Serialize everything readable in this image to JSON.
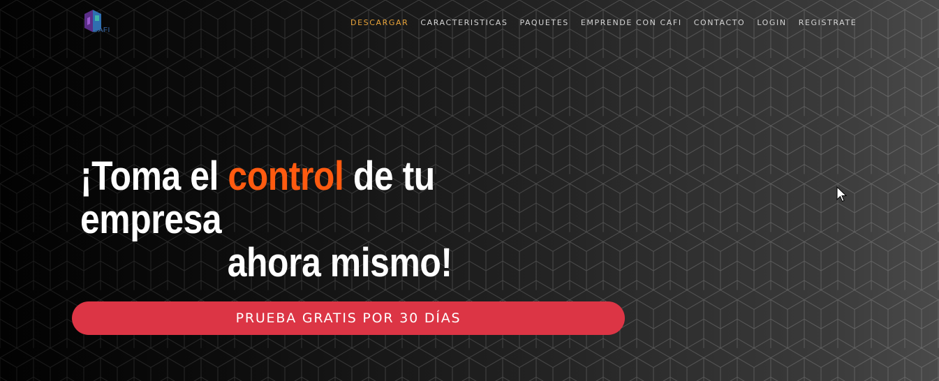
{
  "logo": {
    "text": "CAFI"
  },
  "nav": {
    "items": [
      {
        "label": "DESCARGAR",
        "active": true
      },
      {
        "label": "CARACTERISTICAS"
      },
      {
        "label": "PAQUETES"
      },
      {
        "label": "EMPRENDE CON CAFI"
      },
      {
        "label": "CONTACTO"
      },
      {
        "label": "LOGIN"
      },
      {
        "label": "REGISTRATE"
      }
    ]
  },
  "hero": {
    "headline_prefix": "¡Toma el ",
    "headline_accent": "control",
    "headline_suffix": " de tu empresa",
    "headline_line2": "ahora mismo!",
    "cta_label": "PRUEBA GRATIS POR 30 DÍAS"
  },
  "colors": {
    "nav_active": "#e9a43a",
    "accent": "#ff5a10",
    "cta_background": "#dc3545",
    "background_dark": "#050505",
    "background_light": "#4a4a4a"
  },
  "icons": {
    "logo": "cafi-logo-icon",
    "cursor": "mouse-pointer-icon"
  }
}
